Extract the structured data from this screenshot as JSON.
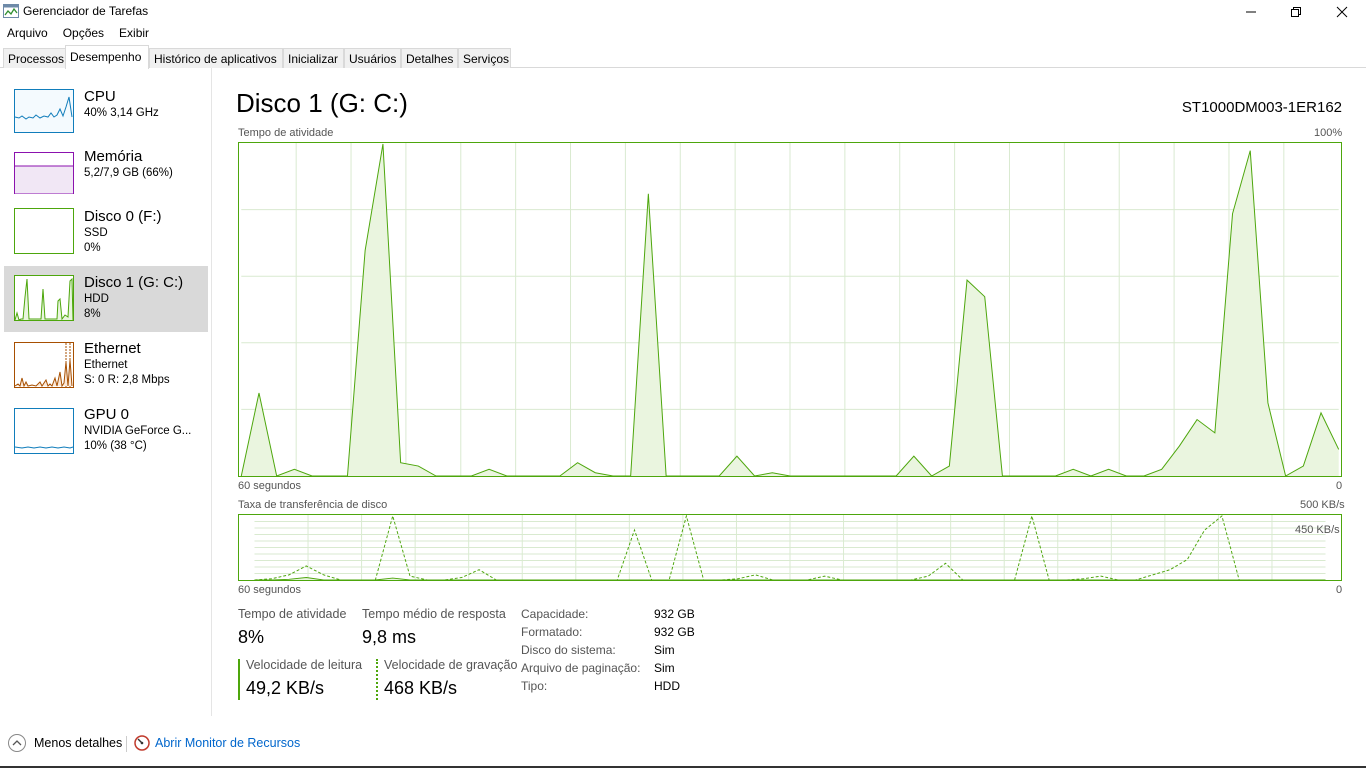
{
  "window": {
    "title": "Gerenciador de Tarefas"
  },
  "menu": [
    "Arquivo",
    "Opções",
    "Exibir"
  ],
  "tabs": [
    "Processos",
    "Desempenho",
    "Histórico de aplicativos",
    "Inicializar",
    "Usuários",
    "Detalhes",
    "Serviços"
  ],
  "active_tab": "Desempenho",
  "sidebar": [
    {
      "title": "CPU",
      "line1": "40% 3,14 GHz",
      "line2": "",
      "color": "#117dbb"
    },
    {
      "title": "Memória",
      "line1": "5,2/7,9 GB (66%)",
      "line2": "",
      "color": "#8b12ae"
    },
    {
      "title": "Disco 0 (F:)",
      "line1": "SSD",
      "line2": "0%",
      "color": "#4da60c"
    },
    {
      "title": "Disco 1 (G: C:)",
      "line1": "HDD",
      "line2": "8%",
      "color": "#4da60c"
    },
    {
      "title": "Ethernet",
      "line1": "Ethernet",
      "line2": "S: 0 R: 2,8 Mbps",
      "color": "#a74f01"
    },
    {
      "title": "GPU 0",
      "line1": "NVIDIA GeForce G...",
      "line2": "10% (38 °C)",
      "color": "#117dbb"
    }
  ],
  "main": {
    "title": "Disco 1 (G: C:)",
    "model": "ST1000DM003-1ER162",
    "activity_chart": {
      "label": "Tempo de atividade",
      "max_label": "100%",
      "time_label": "60 segundos",
      "min_label": "0"
    },
    "transfer_chart": {
      "label": "Taxa de transferência de disco",
      "max_label": "500 KB/s",
      "inner_label": "450 KB/s",
      "time_label": "60 segundos",
      "min_label": "0"
    },
    "stats": {
      "activity_label": "Tempo de atividade",
      "activity_value": "8%",
      "response_label": "Tempo médio de resposta",
      "response_value": "9,8 ms",
      "read_label": "Velocidade de leitura",
      "read_value": "49,2 KB/s",
      "write_label": "Velocidade de gravação",
      "write_value": "468 KB/s"
    },
    "info": [
      {
        "label": "Capacidade:",
        "value": "932 GB"
      },
      {
        "label": "Formatado:",
        "value": "932 GB"
      },
      {
        "label": "Disco do sistema:",
        "value": "Sim"
      },
      {
        "label": "Arquivo de paginação:",
        "value": "Sim"
      },
      {
        "label": "Tipo:",
        "value": "HDD"
      }
    ]
  },
  "chart_data": [
    {
      "type": "area",
      "title": "Tempo de atividade",
      "ylabel": "%",
      "ylim": [
        0,
        100
      ],
      "xlabel": "60 segundos",
      "x": [
        60,
        59,
        58,
        57,
        56,
        55,
        54,
        53,
        52,
        51,
        50,
        49,
        48,
        47,
        46,
        45,
        44,
        43,
        42,
        41,
        40,
        39,
        38,
        37,
        36,
        35,
        34,
        33,
        32,
        31,
        30,
        29,
        28,
        27,
        26,
        25,
        24,
        23,
        22,
        21,
        20,
        19,
        18,
        17,
        16,
        15,
        14,
        13,
        12,
        11,
        10,
        9,
        8,
        7,
        6,
        5,
        4,
        3,
        2,
        1,
        0
      ],
      "series": [
        {
          "values": [
            0,
            25,
            0,
            2,
            0,
            0,
            0,
            68,
            100,
            4,
            3,
            0,
            0,
            0,
            2,
            0,
            0,
            0,
            0,
            4,
            1,
            0,
            0,
            85,
            0,
            0,
            0,
            0,
            6,
            0,
            1,
            0,
            0,
            0,
            0,
            0,
            0,
            0,
            6,
            0,
            3,
            59,
            54,
            0,
            0,
            0,
            0,
            2,
            0,
            2,
            0,
            0,
            2,
            9,
            17,
            13,
            79,
            98,
            22,
            0,
            3,
            19,
            8
          ]
        }
      ]
    },
    {
      "type": "line",
      "title": "Taxa de transferência de disco",
      "ylabel": "KB/s",
      "ylim": [
        0,
        500
      ],
      "xlabel": "60 segundos",
      "series": [
        {
          "name": "Velocidade de leitura",
          "values": [
            0,
            0,
            5,
            20,
            0,
            0,
            0,
            0,
            15,
            0,
            0,
            0,
            0,
            0,
            0,
            0,
            0,
            0,
            0,
            0,
            0,
            0,
            0,
            0,
            0,
            0,
            0,
            0,
            0,
            0,
            0,
            0,
            0,
            0,
            0,
            0,
            0,
            0,
            0,
            0,
            0,
            0,
            0,
            0,
            0,
            0,
            0,
            0,
            0,
            0,
            0,
            0,
            0,
            0,
            0,
            0,
            0,
            0,
            0,
            0,
            0,
            0,
            0
          ]
        },
        {
          "name": "Velocidade de gravação",
          "values": [
            0,
            10,
            40,
            110,
            40,
            0,
            0,
            0,
            500,
            30,
            0,
            0,
            20,
            80,
            0,
            0,
            0,
            0,
            0,
            0,
            0,
            0,
            390,
            0,
            0,
            500,
            0,
            0,
            10,
            40,
            0,
            0,
            0,
            30,
            0,
            0,
            0,
            0,
            0,
            30,
            130,
            0,
            0,
            0,
            0,
            500,
            0,
            0,
            10,
            30,
            0,
            0,
            40,
            80,
            160,
            390,
            500,
            0,
            0,
            0,
            0,
            0,
            0
          ]
        }
      ]
    }
  ]
}
